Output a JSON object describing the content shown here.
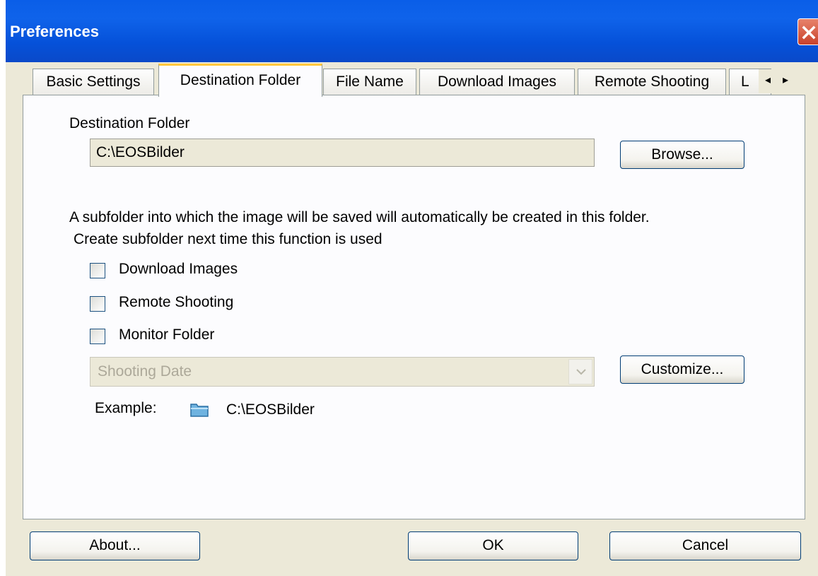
{
  "window": {
    "title": "Preferences",
    "close_icon": "close-icon"
  },
  "tabs": [
    {
      "label": "Basic Settings",
      "active": false
    },
    {
      "label": "Destination Folder",
      "active": true
    },
    {
      "label": "File Name",
      "active": false
    },
    {
      "label": "Download Images",
      "active": false
    },
    {
      "label": "Remote Shooting",
      "active": false
    },
    {
      "label": "L",
      "active": false
    }
  ],
  "tab_scroll": {
    "left_icon": "arrow-left-icon",
    "right_icon": "arrow-right-icon",
    "left": "◂",
    "right": "▸"
  },
  "destination": {
    "section_label": "Destination Folder",
    "path_value": "C:\\EOSBilder",
    "browse_label": "Browse..."
  },
  "subfolder": {
    "description": "A subfolder into which the image will be saved will automatically be created in this folder.",
    "create_label": "Create subfolder next time this function is used",
    "options": [
      {
        "label": "Download Images",
        "checked": false
      },
      {
        "label": "Remote Shooting",
        "checked": false
      },
      {
        "label": "Monitor Folder",
        "checked": false
      }
    ],
    "format_selected": "Shooting Date",
    "customize_label": "Customize...",
    "example_label": "Example:",
    "example_icon": "folder-icon",
    "example_path": "C:\\EOSBilder"
  },
  "footer": {
    "about_label": "About...",
    "ok_label": "OK",
    "cancel_label": "Cancel"
  },
  "colors": {
    "titlebar": "#0a5ee8",
    "dialog_bg": "#ece9d8",
    "active_tab_accent": "#ffc83c",
    "button_border": "#003c74"
  }
}
